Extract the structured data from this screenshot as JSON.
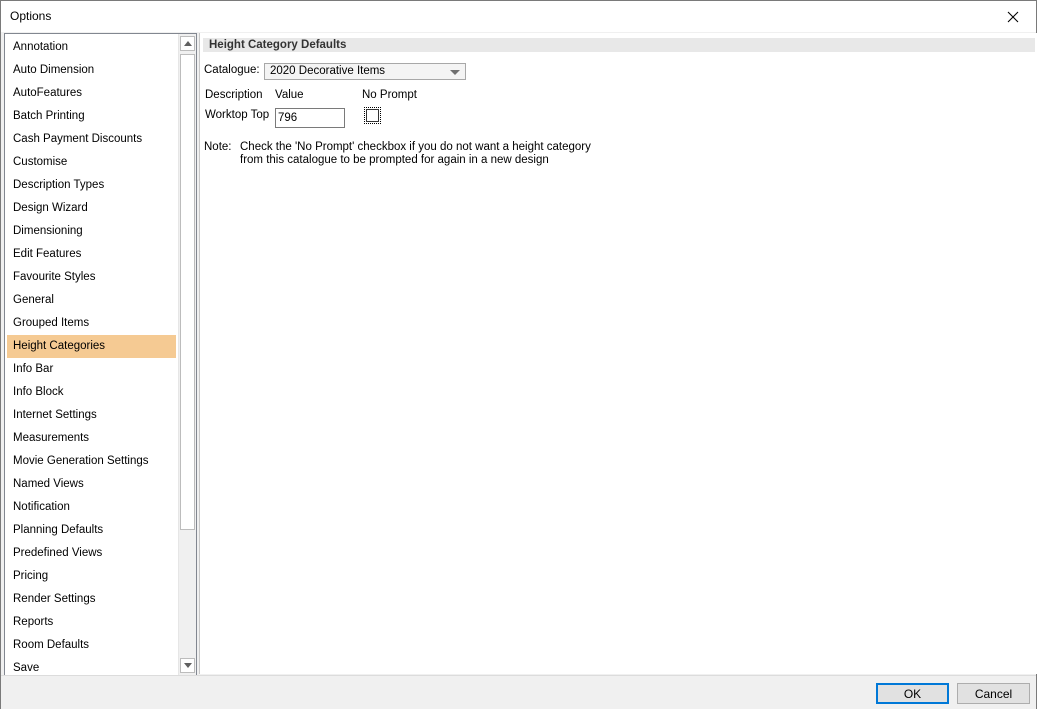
{
  "window": {
    "title": "Options"
  },
  "icons": {
    "close": "close-icon",
    "scroll_up": "chevron-up-icon",
    "scroll_down": "chevron-down-icon"
  },
  "colors": {
    "selected_item_bg": "#f5ca93",
    "ok_button_border": "#0078d7"
  },
  "sidebar": {
    "selected_index": 13,
    "items": [
      "Annotation",
      "Auto Dimension",
      "AutoFeatures",
      "Batch Printing",
      "Cash Payment Discounts",
      "Customise",
      "Description Types",
      "Design Wizard",
      "Dimensioning",
      "Edit Features",
      "Favourite Styles",
      "General",
      "Grouped Items",
      "Height Categories",
      "Info Bar",
      "Info Block",
      "Internet Settings",
      "Measurements",
      "Movie Generation Settings",
      "Named Views",
      "Notification",
      "Planning Defaults",
      "Predefined Views",
      "Pricing",
      "Render Settings",
      "Reports",
      "Room Defaults",
      "Save"
    ]
  },
  "panel": {
    "header": "Height Category Defaults",
    "catalogue_label": "Catalogue:",
    "catalogue_value": "2020 Decorative Items",
    "columns": {
      "description": "Description",
      "value": "Value",
      "no_prompt": "No Prompt"
    },
    "row": {
      "description": "Worktop Top",
      "value": "796",
      "no_prompt_checked": false
    },
    "note_label": "Note:",
    "note_line1": "Check the 'No Prompt' checkbox if you do not want a height category",
    "note_line2": "from this catalogue to be prompted for again in a new design"
  },
  "buttons": {
    "ok": "OK",
    "cancel": "Cancel"
  }
}
